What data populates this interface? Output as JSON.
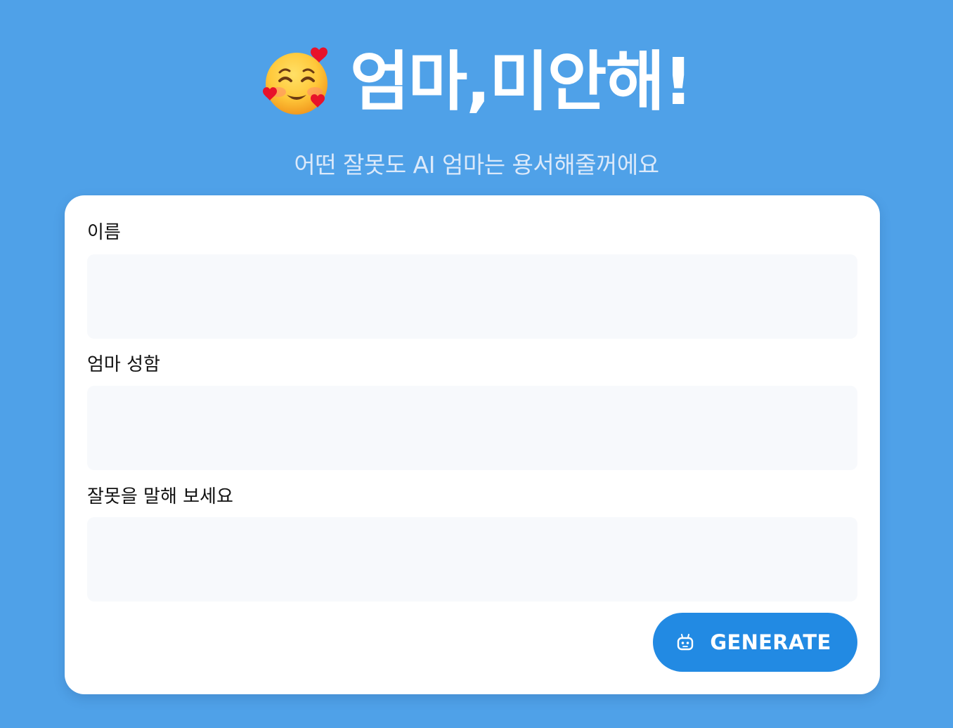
{
  "header": {
    "emoji": "smiling-face-with-hearts",
    "title": "엄마,미안해!",
    "subtitle": "어떤 잘못도 AI 엄마는 용서해줄꺼에요"
  },
  "form": {
    "fields": [
      {
        "label": "이름",
        "value": "",
        "placeholder": ""
      },
      {
        "label": "엄마 성함",
        "value": "",
        "placeholder": ""
      },
      {
        "label": "잘못을 말해 보세요",
        "value": "",
        "placeholder": ""
      }
    ],
    "generate_button": {
      "icon": "robot-icon",
      "label": "GENERATE"
    }
  },
  "colors": {
    "background": "#4fa1e8",
    "card": "#ffffff",
    "input_background": "#f7f9fc",
    "button": "#228ae3",
    "subtitle": "#dbe9fa"
  }
}
